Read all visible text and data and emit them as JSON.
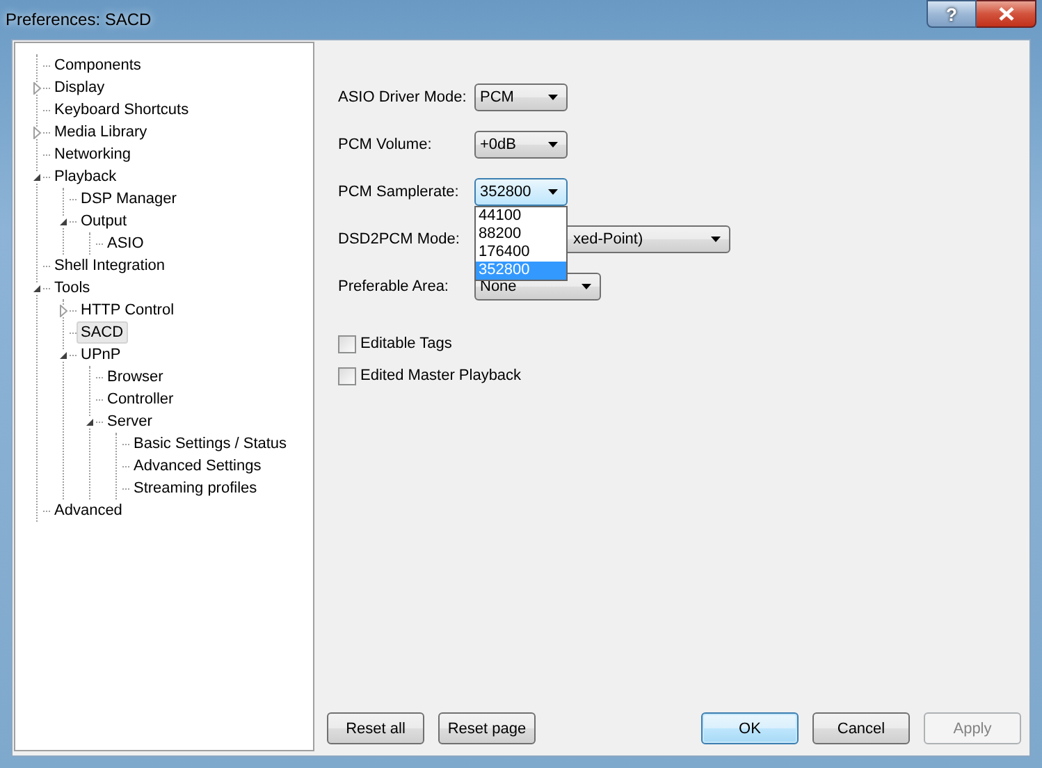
{
  "window": {
    "title": "Preferences: SACD",
    "title_buttons": [
      {
        "kind": "help",
        "label": "?"
      },
      {
        "kind": "close"
      }
    ]
  },
  "tree": [
    {
      "label": "Components",
      "selected": false
    },
    {
      "label": "Display",
      "selected": false,
      "expanded": false
    },
    {
      "label": "Keyboard Shortcuts",
      "selected": false
    },
    {
      "label": "Media Library",
      "selected": false,
      "expanded": false
    },
    {
      "label": "Networking",
      "selected": false
    },
    {
      "label": "Playback",
      "selected": false,
      "expanded": true,
      "children": [
        {
          "label": "DSP Manager",
          "selected": false
        },
        {
          "label": "Output",
          "selected": false,
          "expanded": true,
          "children": [
            {
              "label": "ASIO",
              "selected": false
            }
          ]
        }
      ]
    },
    {
      "label": "Shell Integration",
      "selected": false
    },
    {
      "label": "Tools",
      "selected": false,
      "expanded": true,
      "children": [
        {
          "label": "HTTP Control",
          "selected": false,
          "expanded": false
        },
        {
          "label": "SACD",
          "selected": true
        },
        {
          "label": "UPnP",
          "selected": false,
          "expanded": true,
          "children": [
            {
              "label": "Browser",
              "selected": false
            },
            {
              "label": "Controller",
              "selected": false
            },
            {
              "label": "Server",
              "selected": false,
              "expanded": true,
              "children": [
                {
                  "label": "Basic Settings / Status",
                  "selected": false
                },
                {
                  "label": "Advanced Settings",
                  "selected": false
                },
                {
                  "label": "Streaming profiles",
                  "selected": false
                }
              ]
            }
          ]
        }
      ]
    },
    {
      "label": "Advanced",
      "selected": false
    }
  ],
  "settings": [
    {
      "kind": "combo",
      "label": "ASIO Driver Mode:",
      "value": "PCM",
      "focused": false
    },
    {
      "kind": "combo",
      "label": "PCM Volume:",
      "value": "+0dB",
      "focused": false
    },
    {
      "kind": "combo",
      "label": "PCM Samplerate:",
      "value": "352800",
      "focused": true,
      "dropdown": [
        {
          "label": "44100",
          "selected": false
        },
        {
          "label": "88200",
          "selected": false
        },
        {
          "label": "176400",
          "selected": false
        },
        {
          "label": "352800",
          "selected": true
        }
      ]
    },
    {
      "kind": "combo",
      "label": "DSD2PCM Mode:",
      "value": "xed-Point)",
      "focused": false
    },
    {
      "kind": "combo",
      "label": "Preferable Area:",
      "value": "None",
      "focused": false
    },
    {
      "kind": "checkbox",
      "label": "Editable Tags",
      "checked": false
    },
    {
      "kind": "checkbox",
      "label": "Edited Master Playback",
      "checked": false
    }
  ],
  "buttons": {
    "left": [
      {
        "label": "Reset all",
        "default": false,
        "disabled": false
      },
      {
        "label": "Reset page",
        "default": false,
        "disabled": false
      }
    ],
    "right": [
      {
        "label": "OK",
        "default": true,
        "disabled": false
      },
      {
        "label": "Cancel",
        "default": false,
        "disabled": false
      },
      {
        "label": "Apply",
        "default": false,
        "disabled": true
      }
    ]
  }
}
